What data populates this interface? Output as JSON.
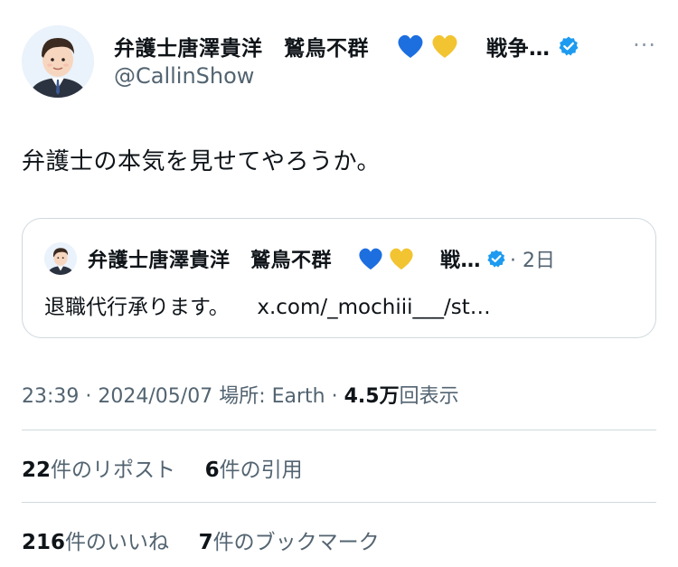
{
  "post": {
    "author": {
      "display_name": "弁護士唐澤貴洋　鷲鳥不群",
      "emoji_suffix_text": "戦争…",
      "handle": "@CallinShow",
      "verified": true
    },
    "text": "弁護士の本気を見せてやろうか。",
    "quote": {
      "display_name": "弁護士唐澤貴洋　鷲鳥不群",
      "emoji_suffix_text": "戦…",
      "date": "· 2日",
      "text": "退職代行承ります。",
      "link": "x.com/_mochiii___/st…"
    },
    "meta": {
      "time": "23:39",
      "sep1": " · ",
      "date": "2024/05/07",
      "location": "場所: Earth",
      "sep2": " · ",
      "views_count": "4.5万",
      "views_label": "回表示"
    },
    "stats": {
      "reposts_count": "22",
      "reposts_label": "件のリポスト",
      "quotes_count": "6",
      "quotes_label": "件の引用",
      "likes_count": "216",
      "likes_label": "件のいいね",
      "bookmarks_count": "7",
      "bookmarks_label": "件のブックマーク"
    },
    "more_icon": "···"
  },
  "icons": {
    "blue_heart": "blue-heart-emoji",
    "yellow_heart": "yellow-heart-emoji",
    "verified": "verified-badge-icon",
    "more": "more-options-icon"
  },
  "colors": {
    "blue_heart": "#1d6fe0",
    "yellow_heart": "#f2c431",
    "verified": "#1d9bf0",
    "text": "#0f1419",
    "secondary": "#536471"
  }
}
